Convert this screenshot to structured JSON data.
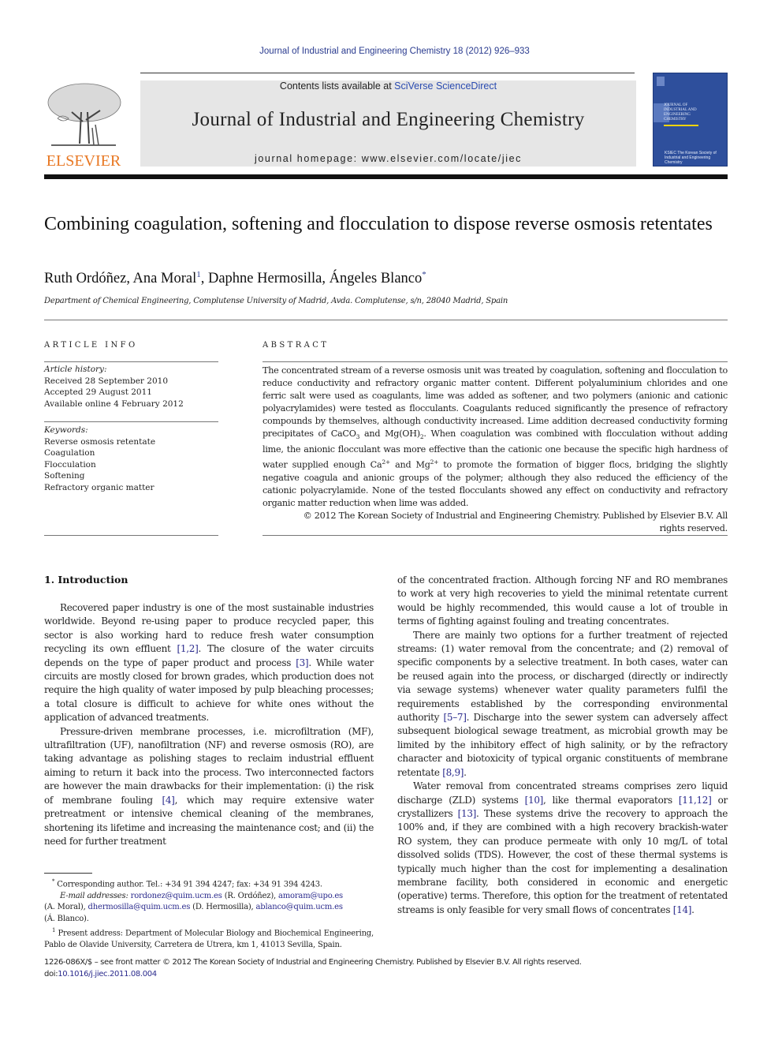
{
  "header": {
    "citation": "Journal of Industrial and Engineering Chemistry 18 (2012) 926–933",
    "contents_prefix": "Contents lists available at ",
    "contents_link": "SciVerse ScienceDirect",
    "journal_title": "Journal of Industrial and Engineering Chemistry",
    "homepage": "journal homepage: www.elsevier.com/locate/jiec",
    "publisher_logo_text": "ELSEVIER",
    "cover_title_lines": [
      "JOURNAL OF",
      "INDUSTRIAL AND",
      "ENGINEERING",
      "CHEMISTRY"
    ],
    "cover_society": "KSIEC The Korean Society of Industrial and Engineering Chemistry"
  },
  "colors": {
    "link": "#2a2a8c",
    "elsevier_orange": "#e87722",
    "cover_blue": "#2e4f9c",
    "banner_gray": "#e6e6e6"
  },
  "article": {
    "title": "Combining coagulation, softening and flocculation to dispose reverse osmosis retentates",
    "authors": [
      {
        "name": "Ruth Ordóñez",
        "mark": ""
      },
      {
        "name": "Ana Moral",
        "mark": "1"
      },
      {
        "name": "Daphne Hermosilla",
        "mark": ""
      },
      {
        "name": "Ángeles Blanco",
        "mark": "*"
      }
    ],
    "affiliation": "Department of Chemical Engineering, Complutense University of Madrid, Avda. Complutense, s/n, 28040 Madrid, Spain"
  },
  "article_info": {
    "heading": "ARTICLE INFO",
    "history_label": "Article history:",
    "history": [
      "Received 28 September 2010",
      "Accepted 29 August 2011",
      "Available online 4 February 2012"
    ],
    "keywords_label": "Keywords:",
    "keywords": [
      "Reverse osmosis retentate",
      "Coagulation",
      "Flocculation",
      "Softening",
      "Refractory organic matter"
    ]
  },
  "abstract": {
    "heading": "ABSTRACT",
    "part1": "The concentrated stream of a reverse osmosis unit was treated by coagulation, softening and flocculation to reduce conductivity and refractory organic matter content. Different polyaluminium chlorides and one ferric salt were used as coagulants, lime was added as softener, and two polymers (anionic and cationic polyacrylamides) were tested as flocculants. Coagulants reduced significantly the presence of refractory compounds by themselves, although conductivity increased. Lime addition decreased conductivity forming precipitates of CaCO",
    "sub1": "3",
    "part2": " and Mg(OH)",
    "sub2": "2",
    "part3": ". When coagulation was combined with flocculation without adding lime, the anionic flocculant was more effective than the cationic one because the specific high hardness of water supplied enough Ca",
    "sup1": "2+",
    "part4": " and Mg",
    "sup2": "2+",
    "part5": " to promote the formation of bigger flocs, bridging the slightly negative coagula and anionic groups of the polymer; although they also reduced the efficiency of the cationic polyacrylamide. None of the tested flocculants showed any effect on conductivity and refractory organic matter reduction when lime was added.",
    "copyright": "© 2012 The Korean Society of Industrial and Engineering Chemistry. Published by Elsevier B.V. All rights reserved."
  },
  "body": {
    "section_heading": "1.  Introduction",
    "left": {
      "p1_a": "Recovered paper industry is one of the most sustainable industries worldwide. Beyond re-using paper to produce recycled paper, this sector is also working hard to reduce fresh water consumption recycling its own effluent ",
      "p1_ref1": "[1,2]",
      "p1_b": ". The closure of the water circuits depends on the type of paper product and process ",
      "p1_ref2": "[3]",
      "p1_c": ". While water circuits are mostly closed for brown grades, which production does not require the high quality of water imposed by pulp bleaching processes; a total closure is difficult to achieve for white ones without the application of advanced treatments.",
      "p2_a": "Pressure-driven membrane processes, i.e. microfiltration (MF), ultrafiltration (UF), nanofiltration (NF) and reverse osmosis (RO), are taking advantage as polishing stages to reclaim industrial effluent aiming to return it back into the process. Two interconnected factors are however the main drawbacks for their implementation: (i) the risk of membrane fouling ",
      "p2_ref1": "[4]",
      "p2_b": ", which may require extensive water pretreatment or intensive chemical cleaning of the membranes, shortening its lifetime and increasing the maintenance cost; and (ii) the need for further treatment"
    },
    "right": {
      "p1": "of the concentrated fraction. Although forcing NF and RO membranes to work at very high recoveries to yield the minimal retentate current would be highly recommended, this would cause a lot of trouble in terms of fighting against fouling and treating concentrates.",
      "p2_a": "There are mainly two options for a further treatment of rejected streams: (1) water removal from the concentrate; and (2) removal of specific components by a selective treatment. In both cases, water can be reused again into the process, or discharged (directly or indirectly via sewage systems) whenever water quality parameters fulfil the requirements established by the corresponding environmental authority ",
      "p2_ref1": "[5–7]",
      "p2_b": ". Discharge into the sewer system can adversely affect subsequent biological sewage treatment, as microbial growth may be limited by the inhibitory effect of high salinity, or by the refractory character and biotoxicity of typical organic constituents of membrane retentate ",
      "p2_ref2": "[8,9]",
      "p2_c": ".",
      "p3_a": "Water removal from concentrated streams comprises zero liquid discharge (ZLD) systems ",
      "p3_ref1": "[10]",
      "p3_b": ", like thermal evaporators ",
      "p3_ref2": "[11,12]",
      "p3_c": " or crystallizers ",
      "p3_ref3": "[13]",
      "p3_d": ". These systems drive the recovery to approach the 100% and, if they are combined with a high recovery brackish-water RO system, they can produce permeate with only 10 mg/L of total dissolved solids (TDS). However, the cost of these thermal systems is typically much higher than the cost for implementing a desalination membrane facility, both considered in economic and energetic (operative) terms. Therefore, this option for the treatment of retentated streams is only feasible for very small flows of concentrates ",
      "p3_ref4": "[14]",
      "p3_e": "."
    }
  },
  "footnotes": {
    "star_mark": "*",
    "corresponding": "Corresponding author. Tel.: +34 91 394 4247; fax: +34 91 394 4243.",
    "email_label": "E-mail addresses:",
    "emails": [
      {
        "address": "rordonez@quim.ucm.es",
        "who": " (R. Ordóñez), "
      },
      {
        "address": "amoram@upo.es",
        "who": " (A. Moral), "
      },
      {
        "address": "dhermosilla@quim.ucm.es",
        "who": " (D. Hermosilla), "
      },
      {
        "address": "ablanco@quim.ucm.es",
        "who": " (Á. Blanco)."
      }
    ],
    "one_mark": "1",
    "present_address": "Present address: Department of Molecular Biology and Biochemical Engineering, Pablo de Olavide University, Carretera de Utrera, km 1, 41013 Sevilla, Spain."
  },
  "bottom": {
    "issn_line": "1226-086X/$ – see front matter © 2012 The Korean Society of Industrial and Engineering Chemistry. Published by Elsevier B.V. All rights reserved.",
    "doi_label": "doi:",
    "doi": "10.1016/j.jiec.2011.08.004"
  }
}
